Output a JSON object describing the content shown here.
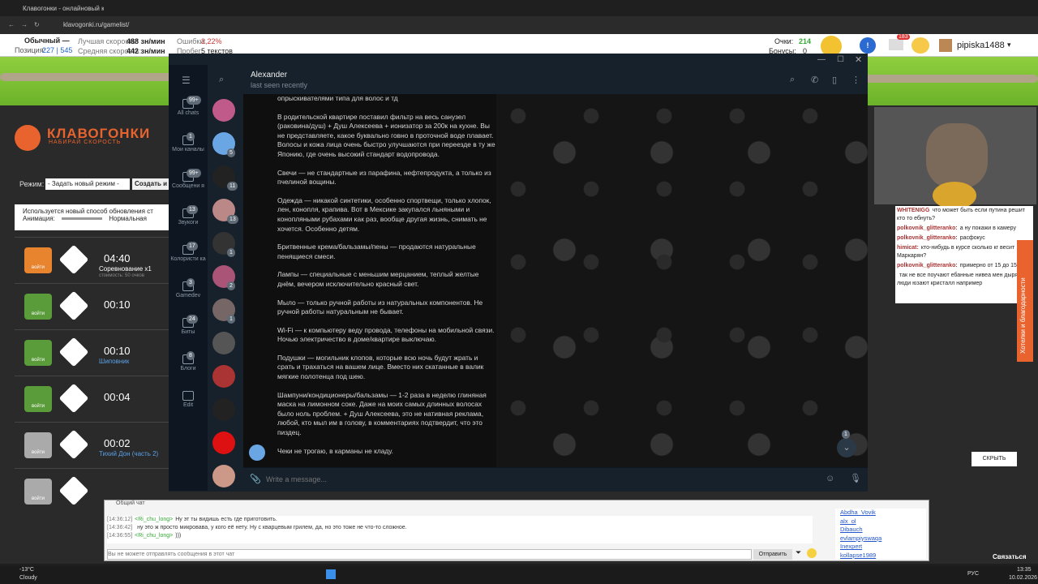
{
  "browser": {
    "tab_title": "Клавогонки - онлайновый кл...",
    "url": "klavogonki.ru/gamelist/"
  },
  "site": {
    "mode_label": "Обычный —",
    "position_label": "Позиция:",
    "position_value": "227 | 545",
    "best_speed_label": "Лучшая скорость:",
    "best_speed": "488 зн/мин",
    "avg_speed_label": "Средняя скорость:",
    "avg_speed": "442 зн/мин",
    "errors_label": "Ошибки:",
    "errors": "3,22%",
    "mileage_label": "Пробег:",
    "mileage": "5 текстов",
    "points_label": "Очки:",
    "points": "214",
    "bonus_label": "Бонусы:",
    "bonus": "0",
    "username": "pipiska1488",
    "notif_count": "183",
    "logo": "КЛАВОГОНКИ",
    "logo_sub": "НАБИРАЙ СКОРОСТЬ",
    "mode_select_label": "Режим:",
    "mode_select_value": "- Задать новый режим -",
    "create_btn": "Создать и",
    "notice": "Используется новый способ обновления ст",
    "animation_label": "Анимация:",
    "animation_value": "Нормальная",
    "hide_btn": "СКРЫТЬ",
    "contact_btn": "Связаться",
    "vertical_banner": "Хотелки и благодарности"
  },
  "races": [
    {
      "go": "войти",
      "time": "04:40",
      "title": "Соревнование x1",
      "sub": "стоимость: 50 очков"
    },
    {
      "go": "войти",
      "time": "00:10",
      "title": "",
      "sub": ""
    },
    {
      "go": "войти",
      "time": "00:10",
      "title": "Шиповник",
      "sub": ""
    },
    {
      "go": "войти",
      "time": "00:04",
      "title": "",
      "sub": ""
    },
    {
      "go": "войти",
      "time": "00:02",
      "title": "Тихий Дон (часть 2)",
      "sub": ""
    },
    {
      "go": "войти",
      "time": "",
      "title": "",
      "sub": ""
    }
  ],
  "telegram": {
    "contact": "Alexander",
    "status": "last seen recently",
    "folders": [
      {
        "label": "All chats",
        "badge": "99+"
      },
      {
        "label": "Мои каналы",
        "badge": "1"
      },
      {
        "label": "Сообщени я",
        "badge": "99+"
      },
      {
        "label": "Звукоги",
        "badge": "13"
      },
      {
        "label": "Колористи ка",
        "badge": "17"
      },
      {
        "label": "Gamedev",
        "badge": "3"
      },
      {
        "label": "Биты",
        "badge": "24"
      },
      {
        "label": "Блоги",
        "badge": "8"
      },
      {
        "label": "Edit",
        "badge": ""
      }
    ],
    "chat_badges": [
      "",
      "5",
      "11",
      "13",
      "1",
      "2",
      "1",
      "",
      "",
      "",
      "",
      ""
    ],
    "messages": [
      "опрыскивателями типа для волос и тд",
      "В родительской квартире поставил фильтр на весь санузел (раковина/душ) + Душ Алексеева + ионизатор за 200к на кухне. Вы не представляете, какое буквально говно в проточной воде плавает. Волосы и кожа лица очень быстро улучшаются при переезде в ту же Японию, где очень высокий стандарт водопровода.",
      "Свечи — не стандартные из парафина, нефтепродукта, а только из пчелиной вощины.",
      "Одежда — никакой синтетики, особенно спортвещи, только хлопок, лен, конопля, крапива. Вот в Мексике закупался льняными и конопляными рубахами как раз, вообще другая жизнь, снимать не хочется. Особенно детям.",
      "Бритвенные крема/бальзамы/пены — продаются натуральные пенящиеся смеси.",
      "Лампы — специальные с меньшим мерцанием, теплый желтые днём, вечером исключительно красный свет.",
      "Мыло — только ручной работы из натуральных компонентов. Не ручной работы натуральным не бывает.",
      "Wi-Fi — к компьютеру веду провода, телефоны на мобильной связи. Ночью электричество в доме/квартире выключаю.",
      "Подушки — могильник клопов, которые всю ночь будут жрать и срать и трахаться на вашем лице. Вместо них скатанные в валик мягкие полотенца под шею.",
      "Шампуни/кондиционеры/бальзамы — 1-2 раза в неделю глиняная маска на лимонном соке. Даже на моих самых длинных волосах было ноль проблем. + Душ Алексеева, это не нативная реклама, любой, кто мыл им в голову, в комментариях подтвердит, что это пиздец.",
      "Чеки не трогаю, в карманы не кладу."
    ],
    "input_placeholder": "Write a message...",
    "scroll_badge": "1"
  },
  "common_chat": {
    "title": "Общий чат",
    "lines": [
      {
        "time": "[14:36:12]",
        "nick": "<Ri_chu_long>",
        "text": "Ну эт ты видишь есть где приготовить."
      },
      {
        "time": "[14:36:42]",
        "nick": "",
        "text": "ну это ж просто микровава, у кого её нету. Ну с кварцевым грилем, да, но это тоже не что-то сложное."
      },
      {
        "time": "[14:36:55]",
        "nick": "<Ri_chu_long>",
        "text": ")))"
      }
    ],
    "input_placeholder": "Вы не можете отправлять сообщения в этот чат",
    "send_btn": "Отправить",
    "users": [
      "Abdha_Vovik",
      "alx_ol",
      "Dibauch",
      "evlampiyswaqa",
      "Inexpert",
      "kollapse1989"
    ]
  },
  "stream": {
    "lines": [
      {
        "nick": "WHITENIGG",
        "text": "что может быть если путина решит кто то ебнуть?"
      },
      {
        "nick": "polkovnik_glitteranko:",
        "text": "а ну покажи в камеру"
      },
      {
        "nick": "polkovnik_glitteranko:",
        "text": "расфокус"
      },
      {
        "nick": "himicat:",
        "text": "кто-нибудь в курсе сколько кг весит Маркарян?"
      },
      {
        "nick": "polkovnik_glitteranko:",
        "text": "примерно от 15 до 1500"
      },
      {
        "nick": "",
        "text": "так не все поучают ебанные нивеа мен дырявый, люди юзают кристалл например"
      }
    ]
  },
  "taskbar": {
    "weather_temp": "-13°C",
    "weather_text": "Cloudy",
    "lang": "РУС",
    "time": "13:35",
    "date": "10.02.2026"
  }
}
